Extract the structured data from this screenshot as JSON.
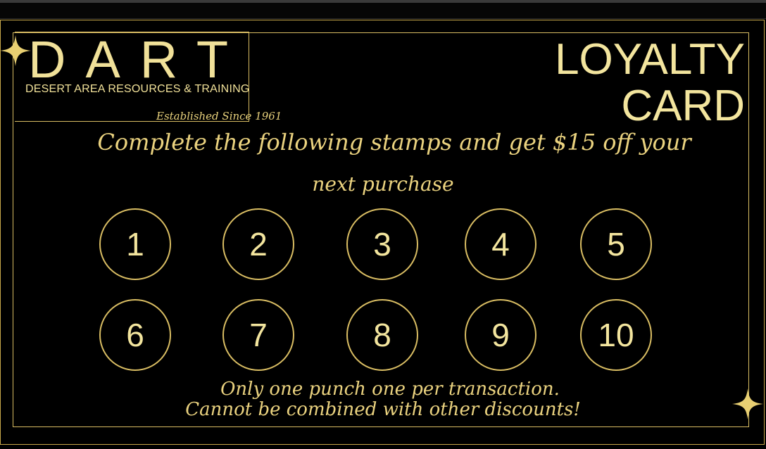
{
  "logo": {
    "wordmark": "DART",
    "subtitle": "DESERT AREA RESOURCES & TRAINING",
    "established": "Established Since 1961"
  },
  "title": {
    "line1": "LOYALTY",
    "line2": "CARD"
  },
  "promo": {
    "line1": "Complete the following stamps and get $15 off your",
    "line2": "next purchase"
  },
  "stamps": [
    "1",
    "2",
    "3",
    "4",
    "5",
    "6",
    "7",
    "8",
    "9",
    "10"
  ],
  "footer": {
    "line1": "Only one punch one per transaction.",
    "line2": "Cannot be combined with other discounts!"
  },
  "colors": {
    "background": "#000000",
    "gold": "#d9bd63",
    "gold_text": "#f1e199"
  },
  "icons": [
    "sparkle-icon",
    "sparkle-icon"
  ]
}
